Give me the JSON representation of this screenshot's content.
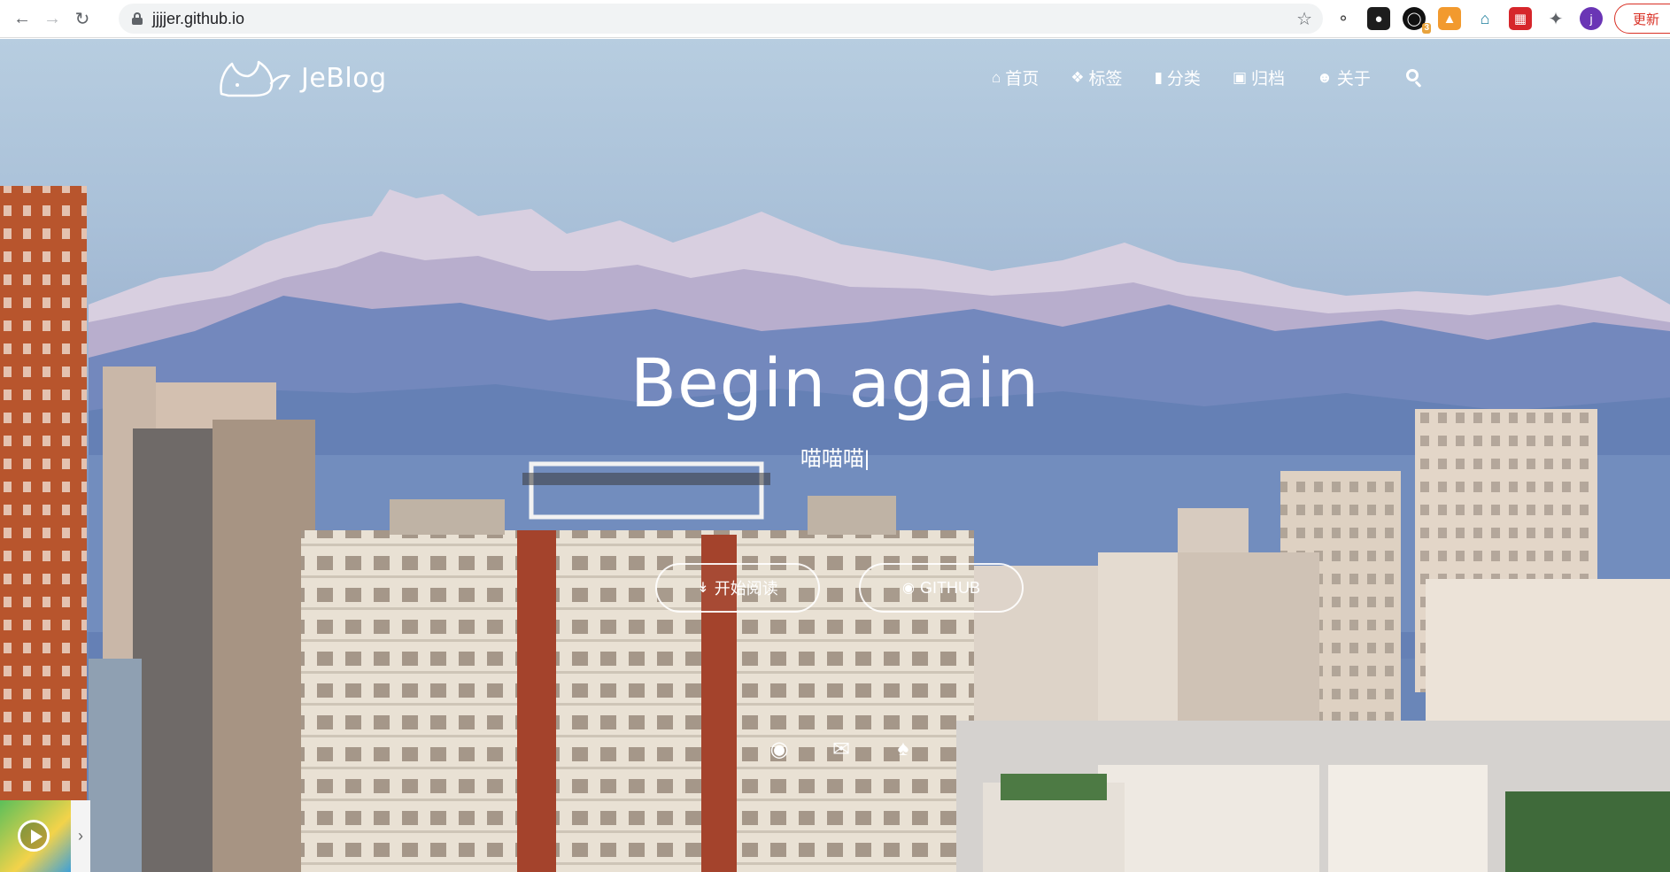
{
  "browser": {
    "url": "jjjjer.github.io",
    "nav": {
      "back_icon": "arrow-left-icon",
      "forward_icon": "arrow-right-icon",
      "reload_icon": "reload-icon"
    },
    "extensions": [
      "broadcast-icon",
      "ghost-extension-icon",
      "ring-extension-icon",
      "fox-wallet-icon",
      "bank-extension-icon",
      "red-grid-extension-icon",
      "puzzle-icon"
    ],
    "extension_badge": "3",
    "profile_initial": "j",
    "update_label": "更新"
  },
  "site": {
    "brand": "JeBlog",
    "nav": [
      {
        "label": "首页",
        "icon": "home-icon"
      },
      {
        "label": "标签",
        "icon": "tags-icon"
      },
      {
        "label": "分类",
        "icon": "bookmark-icon"
      },
      {
        "label": "归档",
        "icon": "archive-icon"
      },
      {
        "label": "关于",
        "icon": "user-circle-icon"
      }
    ],
    "search_icon": "search-icon"
  },
  "hero": {
    "title": "Begin again",
    "subtitle": "喵喵喵|",
    "cta_read": "开始阅读",
    "cta_github": "GITHUB",
    "social": [
      "github-icon",
      "email-icon",
      "qq-icon"
    ]
  },
  "colors": {
    "sky_top": "#b7cde0",
    "sky_mid": "#9cb2cf",
    "mountains": "#6d84b5",
    "update_red": "#d93025",
    "profile_purple": "#6a35b5"
  }
}
